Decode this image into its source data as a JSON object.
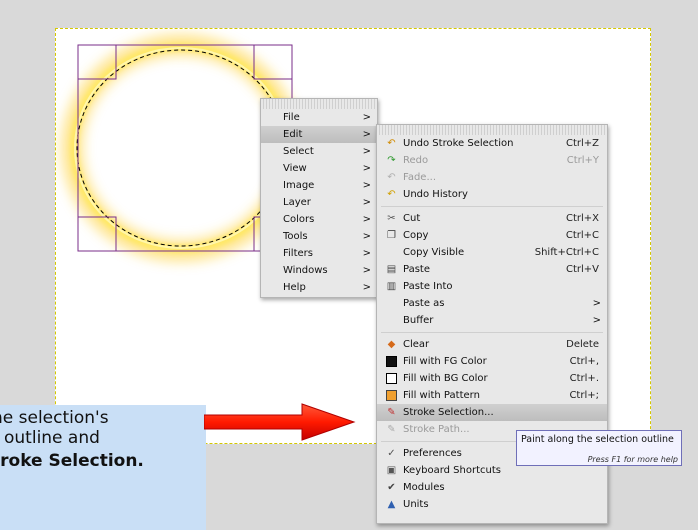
{
  "main_menu": {
    "items": [
      {
        "label": "File",
        "arrow": ">",
        "highlighted": false
      },
      {
        "label": "Edit",
        "arrow": ">",
        "highlighted": true
      },
      {
        "label": "Select",
        "arrow": ">",
        "highlighted": false
      },
      {
        "label": "View",
        "arrow": ">",
        "highlighted": false
      },
      {
        "label": "Image",
        "arrow": ">",
        "highlighted": false
      },
      {
        "label": "Layer",
        "arrow": ">",
        "highlighted": false
      },
      {
        "label": "Colors",
        "arrow": ">",
        "highlighted": false
      },
      {
        "label": "Tools",
        "arrow": ">",
        "highlighted": false
      },
      {
        "label": "Filters",
        "arrow": ">",
        "highlighted": false
      },
      {
        "label": "Windows",
        "arrow": ">",
        "highlighted": false
      },
      {
        "label": "Help",
        "arrow": ">",
        "highlighted": false
      }
    ]
  },
  "edit_menu": {
    "groups": [
      [
        {
          "label": "Undo Stroke Selection",
          "shortcut": "Ctrl+Z",
          "icon": "undo-icon",
          "disabled": false
        },
        {
          "label": "Redo",
          "shortcut": "Ctrl+Y",
          "icon": "redo-icon",
          "disabled": true
        },
        {
          "label": "Fade...",
          "shortcut": "",
          "icon": "fade-icon",
          "disabled": true
        },
        {
          "label": "Undo History",
          "shortcut": "",
          "icon": "undo-history-icon",
          "disabled": false
        }
      ],
      [
        {
          "label": "Cut",
          "shortcut": "Ctrl+X",
          "icon": "scissors-icon",
          "disabled": false
        },
        {
          "label": "Copy",
          "shortcut": "Ctrl+C",
          "icon": "copy-icon",
          "disabled": false
        },
        {
          "label": "Copy Visible",
          "shortcut": "Shift+Ctrl+C",
          "icon": "",
          "disabled": false
        },
        {
          "label": "Paste",
          "shortcut": "Ctrl+V",
          "icon": "paste-icon",
          "disabled": false
        },
        {
          "label": "Paste Into",
          "shortcut": "",
          "icon": "paste-into-icon",
          "disabled": false
        },
        {
          "label": "Paste as",
          "shortcut": "",
          "icon": "",
          "disabled": false,
          "arrow": ">"
        },
        {
          "label": "Buffer",
          "shortcut": "",
          "icon": "",
          "disabled": false,
          "arrow": ">"
        }
      ],
      [
        {
          "label": "Clear",
          "shortcut": "Delete",
          "icon": "eraser-icon",
          "disabled": false
        },
        {
          "label": "Fill with FG Color",
          "shortcut": "Ctrl+,",
          "icon": "fg-swatch-icon",
          "disabled": false
        },
        {
          "label": "Fill with BG Color",
          "shortcut": "Ctrl+.",
          "icon": "bg-swatch-icon",
          "disabled": false
        },
        {
          "label": "Fill with Pattern",
          "shortcut": "Ctrl+;",
          "icon": "pattern-swatch-icon",
          "disabled": false
        },
        {
          "label": "Stroke Selection...",
          "shortcut": "",
          "icon": "stroke-selection-icon",
          "disabled": false,
          "highlighted": true
        },
        {
          "label": "Stroke Path...",
          "shortcut": "",
          "icon": "stroke-path-icon",
          "disabled": true
        }
      ],
      [
        {
          "label": "Preferences",
          "shortcut": "",
          "icon": "preferences-icon",
          "disabled": false
        },
        {
          "label": "Keyboard Shortcuts",
          "shortcut": "",
          "icon": "keyboard-icon",
          "disabled": false
        },
        {
          "label": "Modules",
          "shortcut": "",
          "icon": "modules-icon",
          "disabled": false
        },
        {
          "label": "Units",
          "shortcut": "",
          "icon": "units-icon",
          "disabled": false
        }
      ]
    ]
  },
  "tooltip": {
    "text": "Paint along the selection outline",
    "help": "Press F1 for more help"
  },
  "callout": {
    "lines": [
      "he selection's",
      "outline and",
      "troke Selection."
    ]
  },
  "colors": {
    "fg": "#111111",
    "bg": "#ffffff",
    "pattern": "#f0a030",
    "arrow": "#ff1a00",
    "selection_box": "#7a2d8a",
    "glow": "#ffd800"
  }
}
